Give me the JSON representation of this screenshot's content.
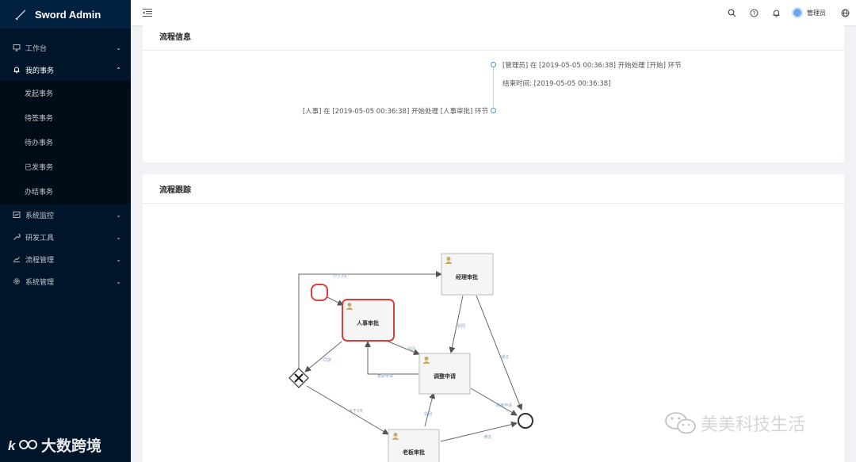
{
  "app": {
    "title": "Sword Admin"
  },
  "sidebar": {
    "items": [
      {
        "label": "工作台",
        "icon": "monitor-icon",
        "open": false
      },
      {
        "label": "我的事务",
        "icon": "bell-icon",
        "open": true,
        "children": [
          "发起事务",
          "待签事务",
          "待办事务",
          "已发事务",
          "办结事务"
        ]
      },
      {
        "label": "系统监控",
        "icon": "dashboard-icon",
        "open": false
      },
      {
        "label": "研发工具",
        "icon": "tool-icon",
        "open": false
      },
      {
        "label": "流程管理",
        "icon": "chart-line-icon",
        "open": false
      },
      {
        "label": "系统管理",
        "icon": "gear-icon",
        "open": false
      }
    ]
  },
  "header": {
    "user_name": "管理员"
  },
  "flow_info": {
    "title": "流程信息",
    "entries": [
      {
        "text": "[管理员] 在 [2019-05-05 00:36:38] 开始处理 [开始] 环节",
        "sub": "结束时间: [2019-05-05 00:36:38]"
      },
      {
        "text": "[人事] 在 [2019-05-05 00:36:38] 开始处理 [人事审批] 环节"
      }
    ]
  },
  "flow_trace": {
    "title": "流程跟踪",
    "nodes": {
      "manager": "经理审批",
      "hr": "人事审批",
      "adjust": "调整申请",
      "boss": "老板审批"
    },
    "edge_labels": {
      "lt3days": "小于3天",
      "agree": "同意",
      "reject1": "驳回",
      "reject2": "驳回",
      "resubmit": "重新申请",
      "pass1": "通过",
      "end_apply": "结束申请",
      "gt3days": "大于3天",
      "reject3": "驳回",
      "pass2": "通过"
    }
  },
  "watermarks": {
    "left": "大数跨境",
    "right": "美美科技生活"
  },
  "colors": {
    "sidebar": "#001529",
    "accent": "#4a90e2",
    "active_node": "#d9403a"
  }
}
